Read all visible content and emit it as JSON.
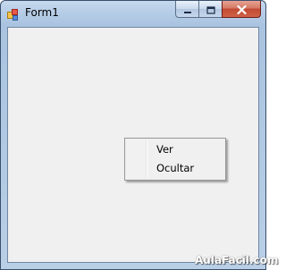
{
  "window": {
    "title": "Form1",
    "icon": "winforms-app-icon"
  },
  "caption_buttons": {
    "minimize_icon": "minimize-icon",
    "maximize_icon": "maximize-icon",
    "close_icon": "close-icon"
  },
  "context_menu": {
    "items": [
      {
        "label": "Ver"
      },
      {
        "label": "Ocultar"
      }
    ]
  },
  "watermark": {
    "text": "AulaFacil.com"
  },
  "colors": {
    "client_background": "#f0f0f0",
    "frame_blue": "#b5cce6",
    "close_button_red": "#c24a32"
  }
}
